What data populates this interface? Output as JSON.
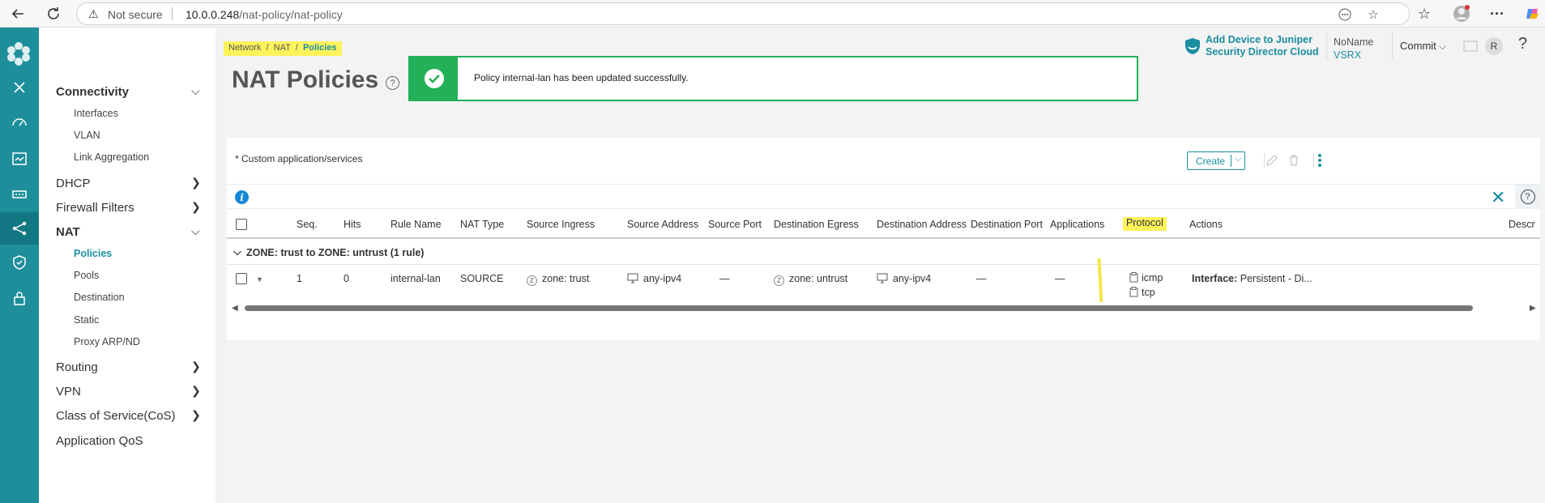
{
  "browser": {
    "security_label": "Not secure",
    "url_host": "10.0.0.248",
    "url_path": "/nat-policy/nat-policy"
  },
  "sidebar": {
    "groups": [
      {
        "label": "Connectivity",
        "expanded": true,
        "items": [
          "Interfaces",
          "VLAN",
          "Link Aggregation"
        ]
      },
      {
        "label": "DHCP",
        "expanded": false
      },
      {
        "label": "Firewall Filters",
        "expanded": false
      },
      {
        "label": "NAT",
        "expanded": true,
        "items": [
          "Policies",
          "Pools",
          "Destination",
          "Static",
          "Proxy ARP/ND"
        ]
      },
      {
        "label": "Routing",
        "expanded": false
      },
      {
        "label": "VPN",
        "expanded": false
      },
      {
        "label": "Class of Service(CoS)",
        "expanded": false
      },
      {
        "label": "Application QoS"
      }
    ],
    "active_item": "Policies"
  },
  "header": {
    "breadcrumb": [
      "Network",
      "NAT",
      "Policies"
    ],
    "title": "NAT Policies",
    "juniper_link_line1": "Add Device to Juniper",
    "juniper_link_line2": "Security Director Cloud",
    "device_name": "NoName",
    "device_model": "VSRX",
    "commit_label": "Commit",
    "avatar_initial": "R",
    "help": "?"
  },
  "toast": {
    "message": "Policy internal-lan has been updated successfully."
  },
  "panel": {
    "note": "* Custom application/services",
    "create_label": "Create",
    "columns": [
      "Seq.",
      "Hits",
      "Rule Name",
      "NAT Type",
      "Source Ingress",
      "Source Address",
      "Source Port",
      "Destination Egress",
      "Destination Address",
      "Destination Port",
      "Applications",
      "Protocol",
      "Actions",
      "Descr"
    ],
    "group_label": "ZONE: trust to ZONE: untrust (1 rule)",
    "row": {
      "seq": "1",
      "hits": "0",
      "rule_name": "internal-lan",
      "nat_type": "SOURCE",
      "source_ingress": "zone: trust",
      "source_address": "any-ipv4",
      "source_port": "—",
      "destination_egress": "zone: untrust",
      "destination_address": "any-ipv4",
      "destination_port": "—",
      "applications": "—",
      "protocols": [
        "icmp",
        "tcp"
      ],
      "actions_label": "Interface:",
      "actions_value": "Persistent - Di..."
    }
  },
  "colors": {
    "accent": "#1b8ea0",
    "rail": "#1e8e9b",
    "success": "#22b058",
    "highlight": "#fff35c"
  }
}
